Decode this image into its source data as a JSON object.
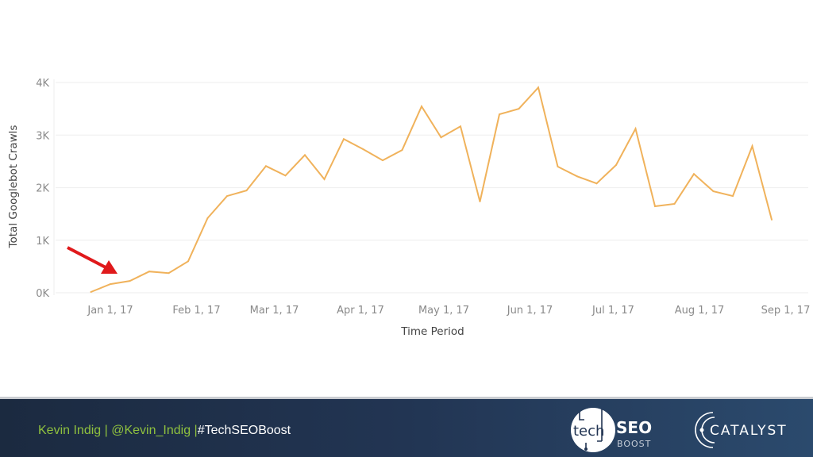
{
  "chart_data": {
    "type": "line",
    "title": "",
    "xlabel": "Time Period",
    "ylabel": "Total Googlebot Crawls",
    "ylim": [
      0,
      4000
    ],
    "y_ticks": [
      {
        "value": 0,
        "label": "0K"
      },
      {
        "value": 1000,
        "label": "1K"
      },
      {
        "value": 2000,
        "label": "2K"
      },
      {
        "value": 3000,
        "label": "3K"
      },
      {
        "value": 4000,
        "label": "4K"
      }
    ],
    "x_ticks": [
      {
        "day": 0,
        "label": "Jan 1, 17"
      },
      {
        "day": 31,
        "label": "Feb 1, 17"
      },
      {
        "day": 59,
        "label": "Mar 1, 17"
      },
      {
        "day": 90,
        "label": "Apr 1, 17"
      },
      {
        "day": 120,
        "label": "May 1, 17"
      },
      {
        "day": 151,
        "label": "Jun 1, 17"
      },
      {
        "day": 181,
        "label": "Jul 1, 17"
      },
      {
        "day": 212,
        "label": "Aug 1, 17"
      },
      {
        "day": 243,
        "label": "Sep 1, 17"
      }
    ],
    "x_unit": "days since Jan 1, 2017 (weekly points)",
    "xlim_days": [
      -10,
      253
    ],
    "grid": true,
    "series": [
      {
        "name": "Total Googlebot Crawls",
        "color": "#f0b25b",
        "x_days": [
          -7,
          0,
          7,
          14,
          21,
          28,
          35,
          42,
          49,
          56,
          63,
          70,
          77,
          84,
          91,
          98,
          105,
          112,
          119,
          126,
          133,
          140,
          147,
          154,
          161,
          168,
          175,
          182,
          189,
          196,
          203,
          210,
          217,
          224,
          231,
          238
        ],
        "values": [
          15,
          165,
          225,
          405,
          375,
          600,
          1420,
          1840,
          1945,
          2410,
          2230,
          2620,
          2160,
          2925,
          2730,
          2520,
          2715,
          3545,
          2955,
          3165,
          1735,
          3395,
          3500,
          3905,
          2400,
          2215,
          2080,
          2430,
          3120,
          1645,
          1690,
          2260,
          1930,
          1840,
          2790,
          1390
        ]
      }
    ],
    "annotations": [
      {
        "type": "arrow",
        "color": "#e0191b",
        "points_to": "early January 2017 (start of growth)"
      }
    ]
  },
  "footer": {
    "author": "Kevin Indig",
    "separator": "|",
    "handle": "@Kevin_Indig",
    "hashtag": "#TechSEOBoost",
    "logos": {
      "tech_seo_boost": {
        "tech": "tech",
        "seo": "SEO",
        "boost": "BOOST"
      },
      "catalyst": {
        "name": "CATALYST"
      }
    }
  },
  "colors": {
    "line": "#f0b25b",
    "arrow": "#e0191b",
    "footer_bg": "#223553",
    "credits_green": "#8fc13e"
  }
}
